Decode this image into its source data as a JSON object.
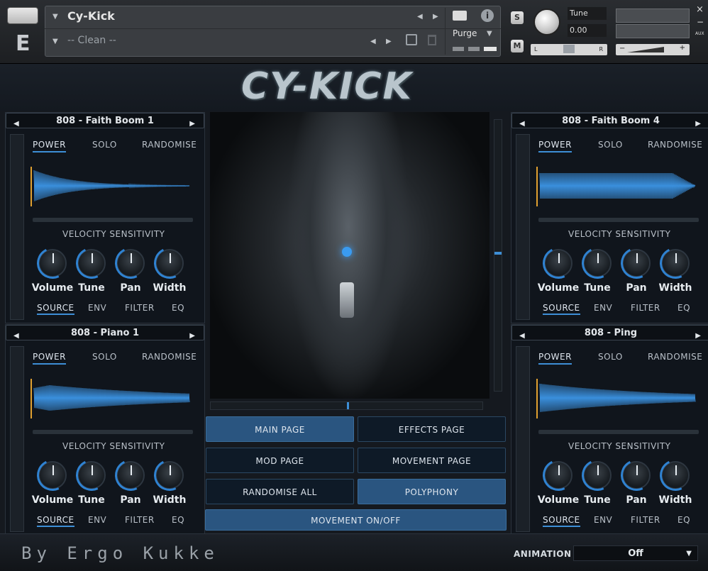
{
  "header": {
    "instrument_name": "Cy-Kick",
    "snapshot_name": "-- Clean --",
    "purge_label": "Purge",
    "tune_label": "Tune",
    "tune_value": "0.00",
    "s_label": "S",
    "m_label": "M",
    "pan_left": "L",
    "pan_right": "R",
    "vol_minus": "−",
    "vol_plus": "+",
    "aux_label": "AUX",
    "close": "×",
    "min": "−",
    "logo_letter": "E"
  },
  "banner": {
    "logo": "CY-KICK"
  },
  "panels": [
    {
      "title": "808 - Faith Boom 1",
      "tabs": [
        "POWER",
        "SOLO",
        "RANDOMISE"
      ],
      "vs_label": "VELOCITY SENSITIVITY",
      "knobs": [
        "Volume",
        "Tune",
        "Pan",
        "Width"
      ],
      "bottom_tabs": [
        "SOURCE",
        "ENV",
        "FILTER",
        "EQ"
      ]
    },
    {
      "title": "808 - Faith Boom 4",
      "tabs": [
        "POWER",
        "SOLO",
        "RANDOMISE"
      ],
      "vs_label": "VELOCITY SENSITIVITY",
      "knobs": [
        "Volume",
        "Tune",
        "Pan",
        "Width"
      ],
      "bottom_tabs": [
        "SOURCE",
        "ENV",
        "FILTER",
        "EQ"
      ]
    },
    {
      "title": "808 - Piano 1",
      "tabs": [
        "POWER",
        "SOLO",
        "RANDOMISE"
      ],
      "vs_label": "VELOCITY SENSITIVITY",
      "knobs": [
        "Volume",
        "Tune",
        "Pan",
        "Width"
      ],
      "bottom_tabs": [
        "SOURCE",
        "ENV",
        "FILTER",
        "EQ"
      ]
    },
    {
      "title": "808 - Ping",
      "tabs": [
        "POWER",
        "SOLO",
        "RANDOMISE"
      ],
      "vs_label": "VELOCITY SENSITIVITY",
      "knobs": [
        "Volume",
        "Tune",
        "Pan",
        "Width"
      ],
      "bottom_tabs": [
        "SOURCE",
        "ENV",
        "FILTER",
        "EQ"
      ]
    }
  ],
  "center": {
    "buttons": [
      "MAIN PAGE",
      "EFFECTS PAGE",
      "MOD PAGE",
      "MOVEMENT PAGE",
      "RANDOMISE ALL",
      "POLYPHONY"
    ],
    "movement": "MOVEMENT ON/OFF"
  },
  "footer": {
    "byline": "By Ergo Kukke",
    "animation_label": "ANIMATION",
    "animation_value": "Off",
    "dropdown_arrow": "▼"
  },
  "colors": {
    "accent": "#2f82d1",
    "active_button": "#2a5580",
    "waveform": "#3a8fdc",
    "playhead": "#e0a030"
  }
}
